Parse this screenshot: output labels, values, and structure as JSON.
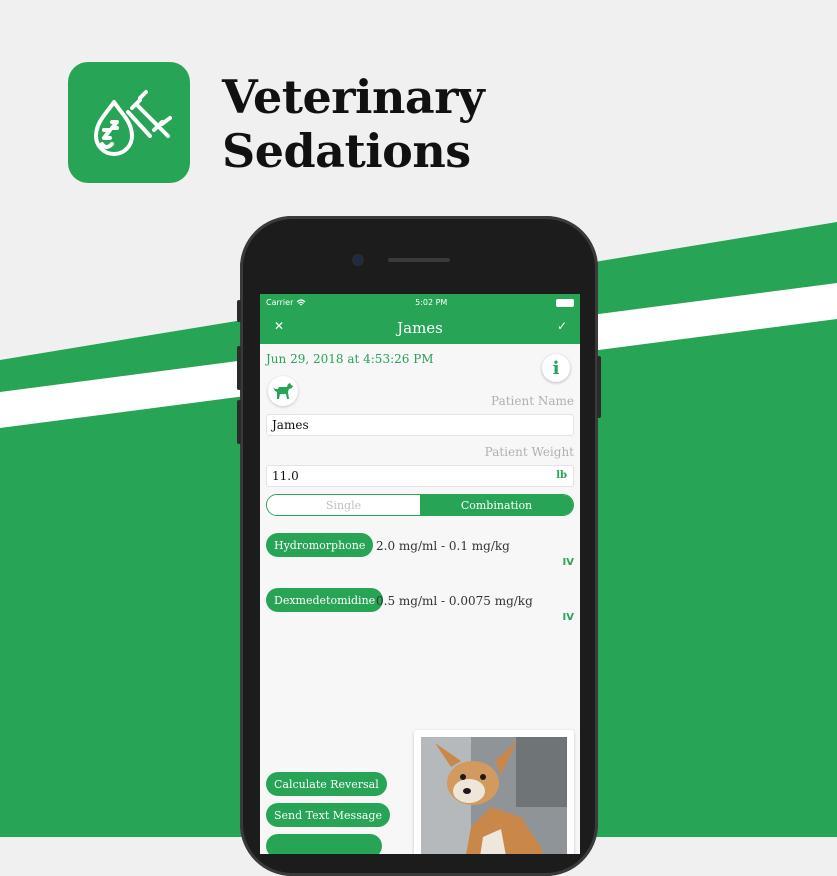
{
  "headline": {
    "line1": "Veterinary",
    "line2": "Sedations"
  },
  "colors": {
    "brand_green": "#27a456",
    "background": "#f0f0f0",
    "label_grey": "#b0b0b0"
  },
  "status_bar": {
    "carrier": "Carrier",
    "time": "5:02 PM"
  },
  "nav": {
    "title": "James",
    "close_icon": "close-icon",
    "done_icon": "checkmark-icon"
  },
  "form": {
    "timestamp": "Jun 29, 2018 at 4:53:26 PM",
    "info_label": "i",
    "patient_name_label": "Patient Name",
    "patient_name_value": "James",
    "patient_weight_label": "Patient Weight",
    "patient_weight_value": "11.0",
    "weight_unit": "lb"
  },
  "mode_toggle": {
    "options": [
      "Single",
      "Combination"
    ],
    "selected": "Combination"
  },
  "drugs": [
    {
      "name": "Hydromorphone",
      "dose": "2.0 mg/ml - 0.1 mg/kg",
      "route": "IV"
    },
    {
      "name": "Dexmedetomidine",
      "dose": "0.5 mg/ml - 0.0075 mg/kg",
      "route": "IV"
    }
  ],
  "actions": {
    "calculate_reversal": "Calculate Reversal",
    "send_text": "Send Text Message"
  }
}
